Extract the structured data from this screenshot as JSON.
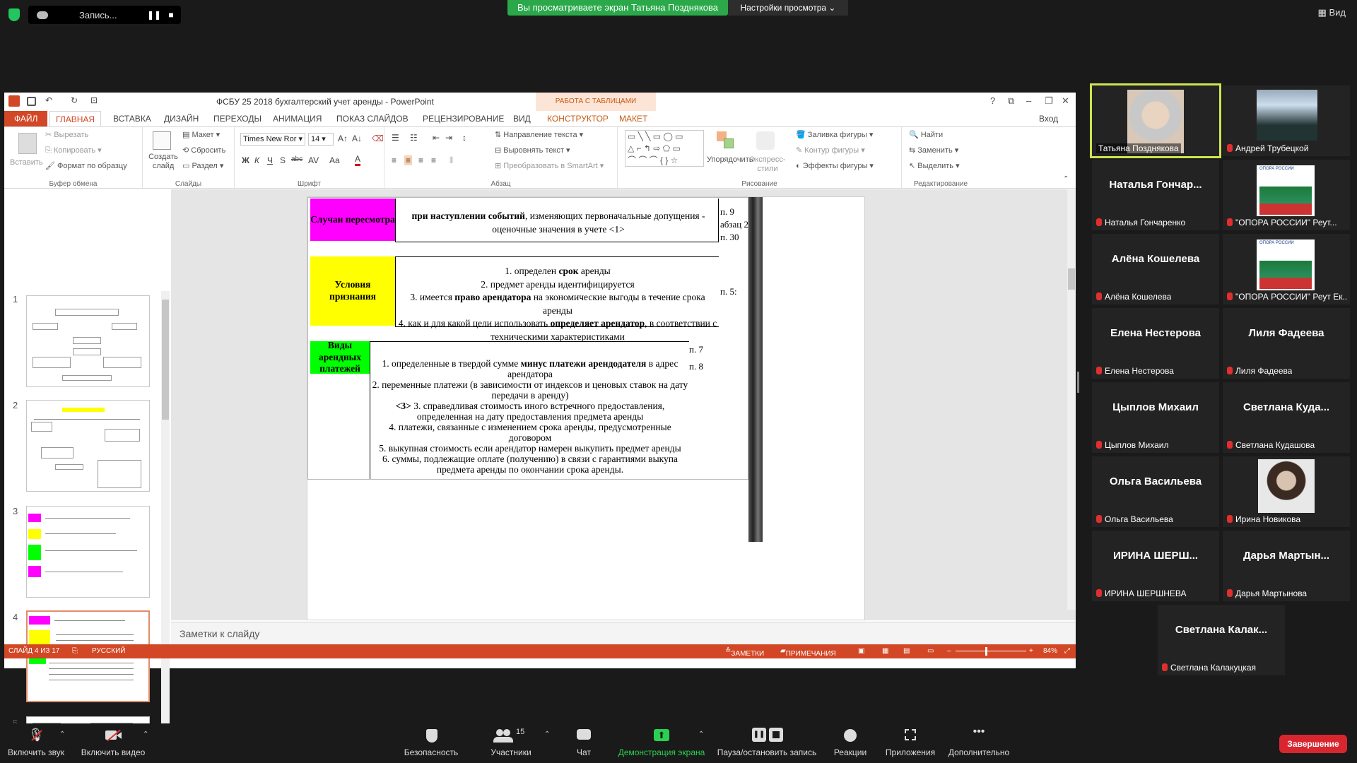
{
  "zoom": {
    "recording_label": "Запись...",
    "viewing_banner": "Вы просматриваете экран Татьяна Позднякова",
    "view_options": "Настройки просмотра",
    "view_button": "Вид",
    "bottom": {
      "mute": "Включить звук",
      "video": "Включить видео",
      "security": "Безопасность",
      "participants": "Участники",
      "participants_count": "15",
      "chat": "Чат",
      "share": "Демонстрация экрана",
      "record": "Пауза/остановить запись",
      "reactions": "Реакции",
      "apps": "Приложения",
      "more": "Дополнительно",
      "end": "Завершение"
    },
    "participants": [
      {
        "label": "Татьяна Позднякова",
        "video": true
      },
      {
        "label": "Андрей Трубецкой",
        "video": true
      },
      {
        "name": "Наталья  Гончар...",
        "label": "Наталья Гончаренко"
      },
      {
        "label": "\"ОПОРА РОССИИ\" Реут...",
        "logo": "ОПОРА РОССИИ"
      },
      {
        "name": "Алёна Кошелева",
        "label": "Алёна Кошелева"
      },
      {
        "label": "\"ОПОРА РОССИИ\" Реут Ек...",
        "logo": "ОПОРА РОССИИ"
      },
      {
        "name": "Елена Нестерова",
        "label": "Елена Нестерова"
      },
      {
        "name": "Лиля Фадеева",
        "label": "Лиля Фадеева"
      },
      {
        "name": "Цыплов Михаил",
        "label": "Цыплов Михаил"
      },
      {
        "name": "Светлана  Куда...",
        "label": "Светлана Кудашова"
      },
      {
        "name": "Ольга Васильева",
        "label": "Ольга Васильева"
      },
      {
        "label": "Ирина Новикова",
        "video": true
      },
      {
        "name": "ИРИНА  ШЕРШ...",
        "label": "ИРИНА ШЕРШНЕВА"
      },
      {
        "name": "Дарья  Мартын...",
        "label": "Дарья Мартынова"
      },
      {
        "name": "Светлана  Калак...",
        "label": "Светлана Калакуцкая"
      }
    ]
  },
  "ppt": {
    "title": "ФСБУ 25 2018 бухгалтерский учет аренды - PowerPoint",
    "context_group": "РАБОТА С ТАБЛИЦАМИ",
    "signin": "Вход",
    "tabs": [
      "ФАЙЛ",
      "ГЛАВНАЯ",
      "ВСТАВКА",
      "ДИЗАЙН",
      "ПЕРЕХОДЫ",
      "АНИМАЦИЯ",
      "ПОКАЗ СЛАЙДОВ",
      "РЕЦЕНЗИРОВАНИЕ",
      "ВИД",
      "КОНСТРУКТОР",
      "МАКЕТ"
    ],
    "ribbon": {
      "paste": "Вставить",
      "cut": "Вырезать",
      "copy": "Копировать",
      "format_painter": "Формат по образцу",
      "clipboard": "Буфер обмена",
      "new_slide": "Создать слайд",
      "layout": "Макет",
      "reset": "Сбросить",
      "section": "Раздел",
      "slides": "Слайды",
      "font_name": "Times New Ror",
      "font_size": "14",
      "font": "Шрифт",
      "text_direction": "Направление текста",
      "align_text": "Выровнять текст",
      "smartart": "Преобразовать в SmartArt",
      "paragraph": "Абзац",
      "arrange": "Упорядочить",
      "quick_styles": "Экспресс-стили",
      "shape_fill": "Заливка фигуры",
      "shape_outline": "Контур фигуры",
      "shape_effects": "Эффекты фигуры",
      "drawing": "Рисование",
      "find": "Найти",
      "replace": "Заменить",
      "select": "Выделить",
      "editing": "Редактирование"
    },
    "thumb_numbers": [
      "1",
      "2",
      "3",
      "4",
      "5"
    ],
    "notes_placeholder": "Заметки к слайду",
    "status": {
      "slide": "СЛАЙД 4 ИЗ 17",
      "lang": "РУССКИЙ",
      "notes": "ЗАМЕТКИ",
      "comments": "ПРИМЕЧАНИЯ",
      "zoom": "84%"
    },
    "slide": {
      "row1_label": "Случаи пересмотра",
      "row1_bold": "при наступлении событий",
      "row1_rest": ", изменяющих первоначальные допущения - оценочные значения в учете <1>",
      "row1_ref": "п. 9 абзац 2, п. 30",
      "row2_label": "Условия признания",
      "row2_l1a": "1. определен ",
      "row2_l1b": "срок",
      "row2_l1c": " аренды",
      "row2_l2": "2. предмет аренды идентифицируется",
      "row2_l3a": "3. имеется ",
      "row2_l3b": "право арендатора",
      "row2_l3c": " на экономические выгоды в течение срока аренды",
      "row2_l4a": "4. как и для какой цели использовать ",
      "row2_l4b": "определяет арендатор",
      "row2_l4c": ", в соответствии с техническими характеристиками",
      "row2_ref": "п. 5:",
      "row3_label": "Виды арендных платежей",
      "row3_ref1": "п. 7",
      "row3_ref2": "п. 8",
      "row3_l1a": "1. определенные в твердой сумме ",
      "row3_l1b": "минус платежи арендодателя",
      "row3_l1c": " в адрес арендатора",
      "row3_l2": "2. переменные платежи (в зависимости от индексов и ценовых ставок на дату передачи в аренду)",
      "row3_l3a": "<3>",
      "row3_l3b": " 3. справедливая стоимость иного встречного предоставления, определенная на дату предоставления предмета аренды",
      "row3_l4": "4. платежи, связанные с изменением срока аренды, предусмотренные договором",
      "row3_l5": "5. выкупная стоимость если арендатор намерен выкупить предмет аренды",
      "row3_l6": "6. суммы, подлежащие оплате (получению) в связи с гарантиями выкупа предмета аренды по окончании срока аренды."
    }
  }
}
